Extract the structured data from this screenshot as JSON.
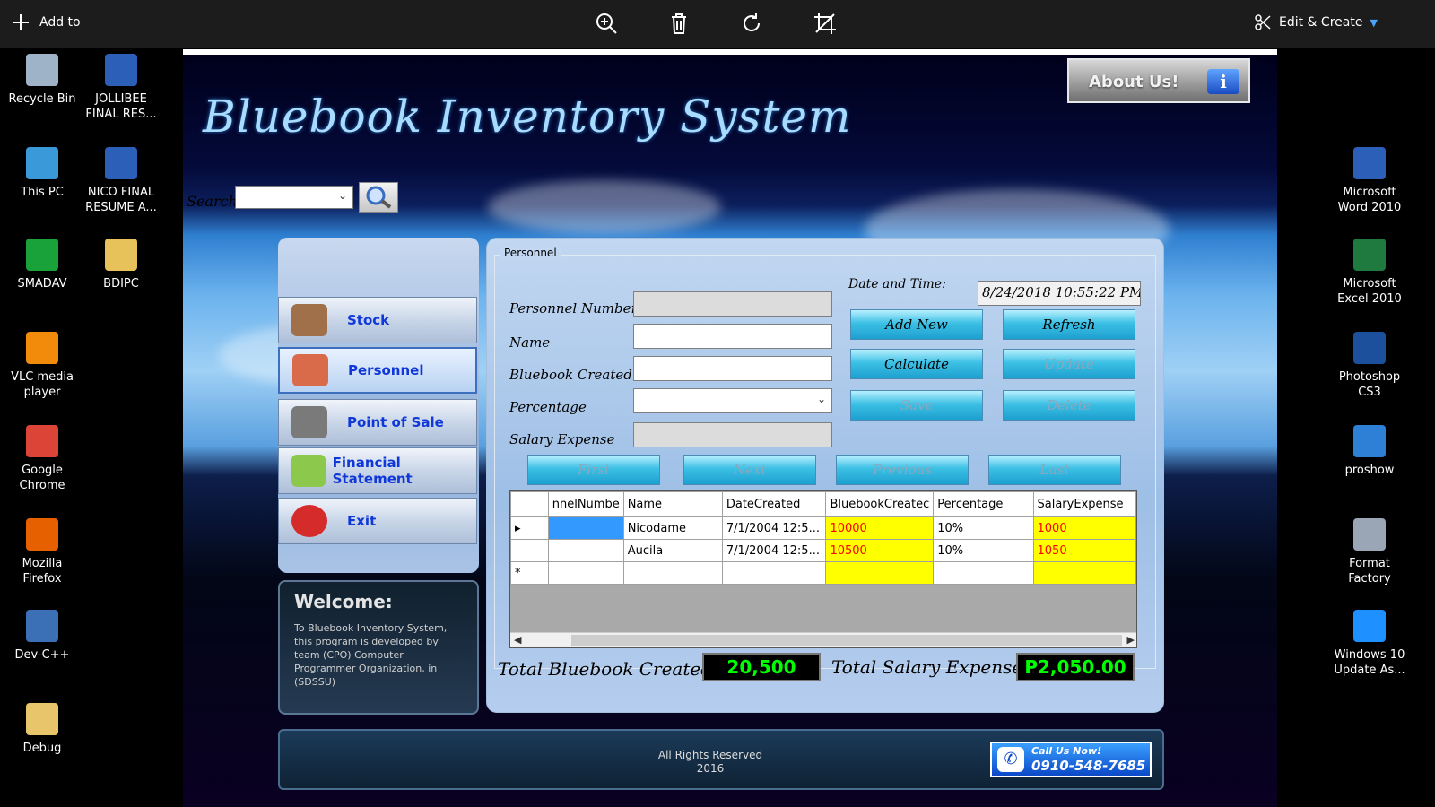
{
  "viewer": {
    "add_to": "Add to",
    "edit_create": "Edit & Create",
    "tools": [
      "zoom-in-icon",
      "delete-icon",
      "rotate-icon",
      "crop-icon"
    ]
  },
  "desktop": {
    "left": [
      {
        "label": "Recycle Bin",
        "icon": "recycle-bin-icon",
        "color": "#9fb3c8"
      },
      {
        "label": "JOLLIBEE FINAL RES...",
        "icon": "word-doc-icon",
        "color": "#2b5fb8"
      },
      {
        "label": "This PC",
        "icon": "computer-icon",
        "color": "#3a9ad9"
      },
      {
        "label": "NICO FINAL RESUME A...",
        "icon": "word-doc-icon",
        "color": "#2b5fb8"
      },
      {
        "label": "SMADAV",
        "icon": "smadav-icon",
        "color": "#19a13a"
      },
      {
        "label": "BDIPC",
        "icon": "file-icon",
        "color": "#e7c25a"
      },
      {
        "label": "VLC media player",
        "icon": "vlc-icon",
        "color": "#f28a0c"
      },
      {
        "label": "Google Chrome",
        "icon": "chrome-icon",
        "color": "#db4437"
      },
      {
        "label": "Mozilla Firefox",
        "icon": "firefox-icon",
        "color": "#e66000"
      },
      {
        "label": "Dev-C++",
        "icon": "devcpp-icon",
        "color": "#3b6fb6"
      },
      {
        "label": "Debug",
        "icon": "folder-icon",
        "color": "#e8c46a"
      }
    ],
    "right": [
      {
        "label": "Microsoft Word 2010",
        "icon": "word-icon",
        "color": "#2b5fb8"
      },
      {
        "label": "Microsoft Excel 2010",
        "icon": "excel-icon",
        "color": "#1f7a3f"
      },
      {
        "label": "Photoshop CS3",
        "icon": "photoshop-icon",
        "color": "#1c4f9c"
      },
      {
        "label": "proshow",
        "icon": "proshow-icon",
        "color": "#2e7fd6"
      },
      {
        "label": "Format Factory",
        "icon": "format-factory-icon",
        "color": "#9aa5b5"
      },
      {
        "label": "Windows 10 Update As...",
        "icon": "windows-icon",
        "color": "#1e90ff"
      }
    ]
  },
  "app": {
    "title": "Bluebook Inventory System",
    "about": "About Us!",
    "search": {
      "label": "Search",
      "value": ""
    },
    "nav": [
      {
        "label": "Stock",
        "icon": "stock-box-icon",
        "color": "#a0704a"
      },
      {
        "label": "Personnel",
        "icon": "personnel-icon",
        "color": "#d96a4a"
      },
      {
        "label": "Point of Sale",
        "icon": "pos-receipt-icon",
        "color": "#7a7a7a"
      },
      {
        "label": "Financial Statement",
        "icon": "money-icon",
        "color": "#8cc84b"
      },
      {
        "label": "Exit",
        "icon": "power-icon",
        "color": "#d62b2b"
      }
    ],
    "welcome": {
      "title": "Welcome:",
      "text": "To Bluebook Inventory System, this program is developed by team (CPO) Computer Programmer Organization, in (SDSSU)"
    },
    "personnel": {
      "group": "Personnel",
      "fields": {
        "number": {
          "label": "Personnel Number",
          "value": ""
        },
        "name": {
          "label": "Name",
          "value": ""
        },
        "bluebook": {
          "label": "Bluebook Created",
          "value": ""
        },
        "percentage": {
          "label": "Percentage",
          "value": ""
        },
        "salary": {
          "label": "Salary Expense",
          "value": ""
        }
      },
      "date_label": "Date and Time:",
      "date_value": "8/24/2018 10:55:22 PM",
      "buttons": {
        "add_new": "Add New",
        "refresh": "Refresh",
        "calculate": "Calculate",
        "update": "Update",
        "save": "Save",
        "delete": "Delete",
        "first": "First",
        "next": "Next",
        "previous": "Previous",
        "last": "Last"
      },
      "grid": {
        "columns": [
          "nnelNumbe",
          "Name",
          "DateCreated",
          "BluebookCreatec",
          "Percentage",
          "SalaryExpense"
        ],
        "rows": [
          [
            "",
            "Nicodame",
            "7/1/2004 12:5...",
            "10000",
            "10%",
            "1000"
          ],
          [
            "",
            "Aucila",
            "7/1/2004 12:5...",
            "10500",
            "10%",
            "1050"
          ]
        ]
      },
      "totals": {
        "bluebook_label": "Total Bluebook Created",
        "bluebook_value": "20,500",
        "salary_label": "Total Salary Expense",
        "salary_value": "P2,050.00"
      }
    },
    "footer": {
      "rights_line1": "All Rights Reserved",
      "rights_line2": "2016",
      "call_line1": "Call Us Now!",
      "call_line2": "0910-548-7685"
    }
  }
}
